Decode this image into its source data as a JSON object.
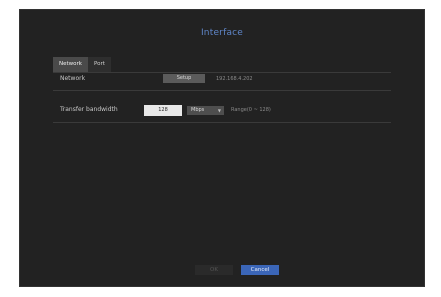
{
  "dialog": {
    "title": "Interface"
  },
  "tabs": [
    {
      "label": "Network",
      "active": true
    },
    {
      "label": "Port",
      "active": false
    }
  ],
  "network_row": {
    "label": "Network",
    "setup_label": "Setup",
    "ip_address": "192.168.4.202"
  },
  "bandwidth_row": {
    "label": "Transfer bandwidth",
    "value": "128",
    "unit": "Mbps",
    "range": "Range(0 ~ 128)"
  },
  "footer": {
    "ok_label": "OK",
    "cancel_label": "Cancel"
  },
  "colors": {
    "accent": "#3b66b8",
    "title": "#5f86c9",
    "background": "#222222"
  }
}
